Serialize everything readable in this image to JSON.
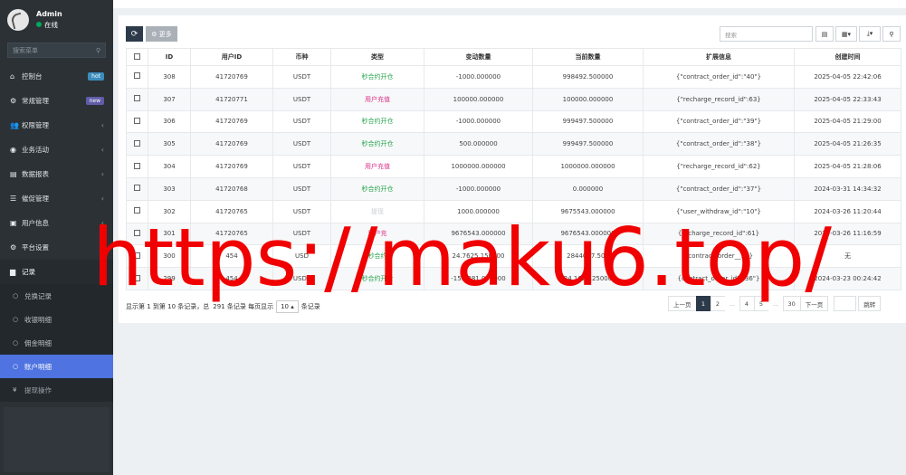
{
  "sidebar": {
    "user": {
      "name": "Admin",
      "status": "在线"
    },
    "search_placeholder": "搜索菜单",
    "items": [
      {
        "label": "控制台",
        "icon": "dashboard-icon",
        "icon_char": "⌂",
        "badge": "hot"
      },
      {
        "label": "常规管理",
        "icon": "cogs-icon",
        "icon_char": "⚙",
        "badge": "new"
      },
      {
        "label": "权限管理",
        "icon": "group-icon",
        "icon_char": "👥"
      },
      {
        "label": "业务活动",
        "icon": "circle-icon",
        "icon_char": "◉"
      },
      {
        "label": "数据报表",
        "icon": "file-icon",
        "icon_char": "▤"
      },
      {
        "label": "催促管理",
        "icon": "list-icon",
        "icon_char": "☰"
      },
      {
        "label": "用户信息",
        "icon": "user-card-icon",
        "icon_char": "▣"
      },
      {
        "label": "平台设置",
        "icon": "settings-icon",
        "icon_char": "⚙"
      },
      {
        "label": "记录",
        "icon": "chart-icon",
        "icon_char": "▆"
      }
    ],
    "sub_items": [
      {
        "label": "兑换记录",
        "icon_char": "○"
      },
      {
        "label": "收银明细",
        "icon_char": "○"
      },
      {
        "label": "佣金明细",
        "icon_char": "○"
      },
      {
        "label": "账户明细",
        "icon_char": "○"
      }
    ],
    "last_item": {
      "label": "提现操作",
      "icon_char": "¥"
    },
    "chevron": "‹",
    "chevron_open": "⌄"
  },
  "toolbar": {
    "refresh_icon": "⟳",
    "more_label": "⚙ 更多",
    "search_placeholder": "搜索",
    "btn_print": "▤",
    "btn_columns": "▦▾",
    "btn_export": "⤓▾",
    "btn_search": "⚲"
  },
  "table": {
    "headers": [
      "",
      "ID",
      "用户ID",
      "币种",
      "类型",
      "变动数量",
      "当前数量",
      "扩展信息",
      "创建时间"
    ],
    "rows": [
      {
        "id": "308",
        "uid": "41720769",
        "coin": "USDT",
        "type": "秒合约开仓",
        "type_class": "type-green",
        "change": "-1000.000000",
        "current": "998492.500000",
        "ext": "{\"contract_order_id\":\"40\"}",
        "time": "2025-04-05 22:42:06"
      },
      {
        "id": "307",
        "uid": "41720771",
        "coin": "USDT",
        "type": "用户充值",
        "type_class": "type-pink",
        "change": "100000.000000",
        "current": "100000.000000",
        "ext": "{\"recharge_record_id\":63}",
        "time": "2025-04-05 22:33:43"
      },
      {
        "id": "306",
        "uid": "41720769",
        "coin": "USDT",
        "type": "秒合约开仓",
        "type_class": "type-green",
        "change": "-1000.000000",
        "current": "999497.500000",
        "ext": "{\"contract_order_id\":\"39\"}",
        "time": "2025-04-05 21:29:00"
      },
      {
        "id": "305",
        "uid": "41720769",
        "coin": "USDT",
        "type": "秒合约开仓",
        "type_class": "type-green",
        "change": "500.000000",
        "current": "999497.500000",
        "ext": "{\"contract_order_id\":\"38\"}",
        "time": "2025-04-05 21:26:35"
      },
      {
        "id": "304",
        "uid": "41720769",
        "coin": "USDT",
        "type": "用户充值",
        "type_class": "type-pink",
        "change": "1000000.000000",
        "current": "1000000.000000",
        "ext": "{\"recharge_record_id\":62}",
        "time": "2025-04-05 21:28:06"
      },
      {
        "id": "303",
        "uid": "41720768",
        "coin": "USDT",
        "type": "秒合约开仓",
        "type_class": "type-green",
        "change": "-1000.000000",
        "current": "0.000000",
        "ext": "{\"contract_order_id\":\"37\"}",
        "time": "2024-03-31 14:34:32"
      },
      {
        "id": "302",
        "uid": "41720765",
        "coin": "USDT",
        "type": "提现",
        "type_class": "type-gray",
        "change": "1000.000000",
        "current": "9675543.000000",
        "ext": "{\"user_withdraw_id\":\"10\"}",
        "time": "2024-03-26 11:20:44"
      },
      {
        "id": "301",
        "uid": "41720765",
        "coin": "USDT",
        "type": "用户充",
        "type_class": "type-pink",
        "change": "9676543.000000",
        "current": "9676543.000000",
        "ext": "{recharge_record_id\":61}",
        "time": "2024-03-26 11:16:59"
      },
      {
        "id": "300",
        "uid": "454",
        "coin": "USD",
        "type": "秒合约",
        "type_class": "type-green",
        "change": "24.7625.150000",
        "current": "2844097.500",
        "ext": "{contract_order__36}",
        "time": "无"
      },
      {
        "id": "299",
        "uid": "454",
        "coin": "USDT",
        "type": "秒合约开仓",
        "type_class": "type-green",
        "change": "-15.5381.000000",
        "current": "24.1627.25000",
        "ext": "{contract_order_id\":\"36\"}",
        "time": "2024-03-23 00:24:42"
      }
    ]
  },
  "pagination": {
    "info_prefix": "显示第 1 到第 10 条记录，总",
    "info_total": "291 条记录 每页显示",
    "page_size": "10 ▴",
    "info_suffix": "条记录",
    "prev": "上一页",
    "pages": [
      "1",
      "2",
      "...",
      "4",
      "5",
      "...",
      "30"
    ],
    "next": "下一页",
    "jump": "跳转"
  },
  "watermark": "https://maku6.top/"
}
